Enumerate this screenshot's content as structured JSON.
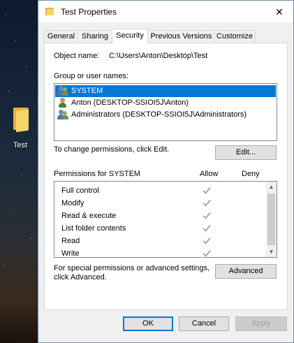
{
  "desktop": {
    "shortcut_label": "Test"
  },
  "window": {
    "title": "Test Properties",
    "close_glyph": "✕"
  },
  "tabs": [
    {
      "label": "General"
    },
    {
      "label": "Sharing"
    },
    {
      "label": "Security"
    },
    {
      "label": "Previous Versions"
    },
    {
      "label": "Customize"
    }
  ],
  "security": {
    "object_name_label": "Object name:",
    "object_name_value": "C:\\Users\\Anton\\Desktop\\Test",
    "group_label": "Group or user names:",
    "users": [
      {
        "name": "SYSTEM",
        "icon": "group-users-icon"
      },
      {
        "name": "Anton (DESKTOP-SSIOI5J\\Anton)",
        "icon": "user-icon"
      },
      {
        "name": "Administrators (DESKTOP-SSIOI5J\\Administrators)",
        "icon": "group-users-icon"
      }
    ],
    "change_text": "To change permissions, click Edit.",
    "edit_label": "Edit...",
    "permissions_header": "Permissions for SYSTEM",
    "allow_header": "Allow",
    "deny_header": "Deny",
    "permissions": [
      {
        "name": "Full control",
        "allow": true,
        "deny": false
      },
      {
        "name": "Modify",
        "allow": true,
        "deny": false
      },
      {
        "name": "Read & execute",
        "allow": true,
        "deny": false
      },
      {
        "name": "List folder contents",
        "allow": true,
        "deny": false
      },
      {
        "name": "Read",
        "allow": true,
        "deny": false
      },
      {
        "name": "Write",
        "allow": true,
        "deny": false
      }
    ],
    "special_text_line1": "For special permissions or advanced settings,",
    "special_text_line2": "click Advanced.",
    "advanced_label": "Advanced"
  },
  "footer": {
    "ok_label": "OK",
    "cancel_label": "Cancel",
    "apply_label": "Apply"
  },
  "colors": {
    "selection": "#0078d7",
    "window_bg": "#f0f0f0"
  }
}
